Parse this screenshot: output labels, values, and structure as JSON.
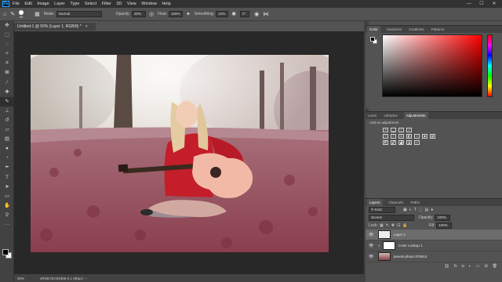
{
  "menu": [
    "File",
    "Edit",
    "Image",
    "Layer",
    "Type",
    "Select",
    "Filter",
    "3D",
    "View",
    "Window",
    "Help"
  ],
  "logo": "Ps",
  "window_controls": [
    "—",
    "☐",
    "✕"
  ],
  "options": {
    "brush_size": "65",
    "mode_label": "Mode:",
    "mode_value": "Normal",
    "opacity_label": "Opacity:",
    "opacity_value": "30%",
    "flow_label": "Flow:",
    "flow_value": "100%",
    "smoothing_label": "Smoothing:",
    "smoothing_value": "10%",
    "angle_value": "0°"
  },
  "document": {
    "tab_title": "Untitled-1 @ 50% (Layer 1, RGB/8) *",
    "tab_close": "×",
    "zoom": "50%",
    "profile": "sRGB IEC61966-2.1 (8bpc)"
  },
  "color_panel": {
    "tabs": [
      "Color",
      "Swatches",
      "Gradients",
      "Patterns"
    ],
    "active_tab": "Color",
    "hue_color": "#ff0000"
  },
  "adjust_panel": {
    "tabs": [
      "Learn",
      "Libraries",
      "Adjustments"
    ],
    "active_tab": "Adjustments",
    "title": "Add an adjustment",
    "row1_icons": [
      "brightness-icon",
      "levels-icon",
      "curves-icon",
      "exposure-icon"
    ],
    "row2_icons": [
      "vibrance-icon",
      "hue-sat-icon",
      "color-balance-icon",
      "bw-icon",
      "photo-filter-icon",
      "channel-mixer-icon",
      "color-lookup-icon"
    ],
    "row3_icons": [
      "invert-icon",
      "posterize-icon",
      "threshold-icon",
      "selective-color-icon",
      "gradient-map-icon"
    ]
  },
  "layers_panel": {
    "tabs": [
      "Layers",
      "Channels",
      "Paths"
    ],
    "active_tab": "Layers",
    "filter_label": "Kind",
    "blend_mode": "Screen",
    "opacity_label": "Opacity:",
    "opacity_value": "100%",
    "lock_label": "Lock:",
    "fill_label": "Fill:",
    "fill_value": "100%",
    "layers": [
      {
        "name": "Layer 1",
        "selected": true
      },
      {
        "name": "Color Lookup 1",
        "selected": false
      },
      {
        "name": "pexels-photo-375613",
        "selected": false
      }
    ]
  }
}
